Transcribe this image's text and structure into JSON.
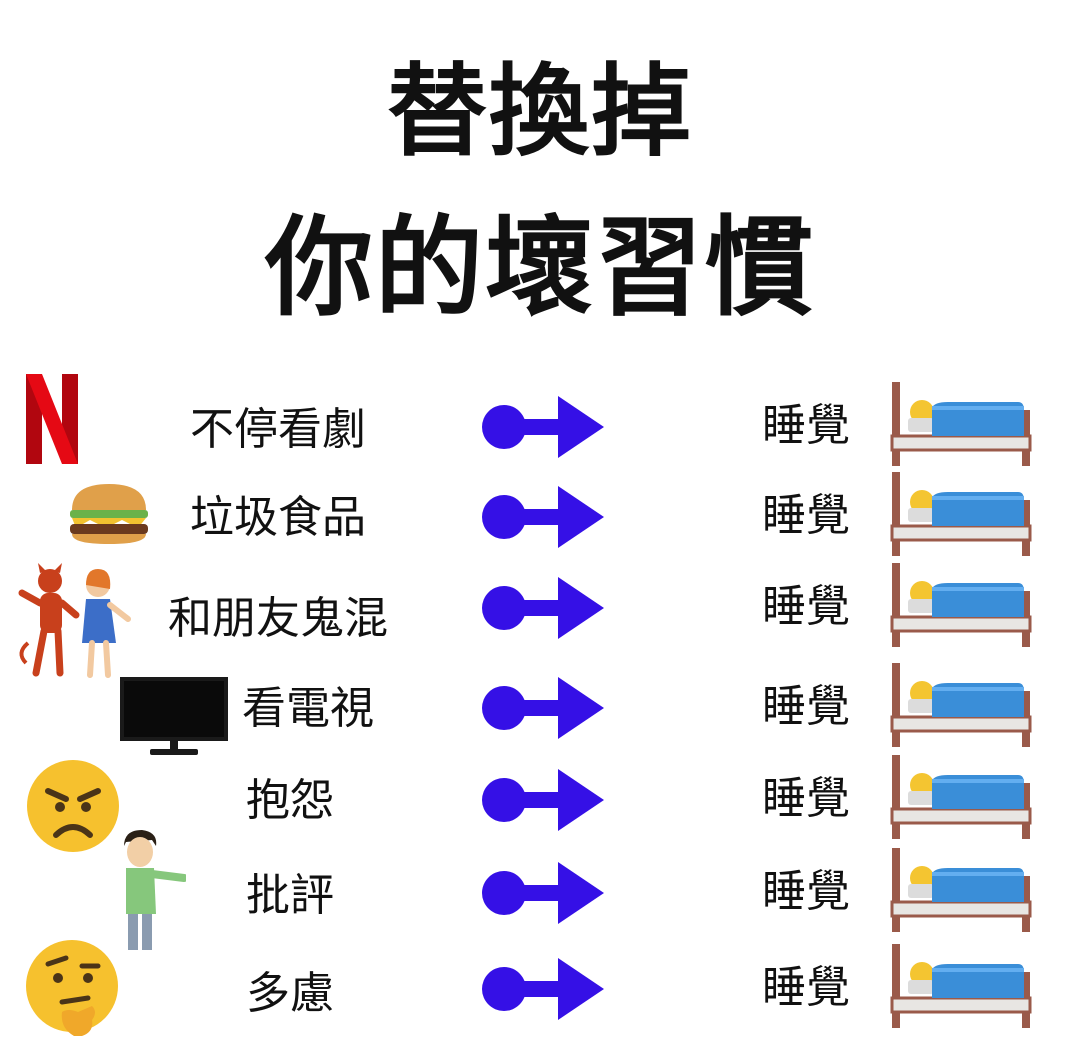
{
  "title": {
    "line1": "替換掉",
    "line2": "你的壞習慣"
  },
  "arrow_color": "#3510e6",
  "rows": [
    {
      "icon": "netflix-logo-icon",
      "habit": "不停看劇",
      "result": "睡覺",
      "result_icon": "person-in-bed-icon"
    },
    {
      "icon": "hamburger-icon",
      "habit": "垃圾食品",
      "result": "睡覺",
      "result_icon": "person-in-bed-icon"
    },
    {
      "icon": "devil-and-girl-icon",
      "habit": "和朋友鬼混",
      "result": "睡覺",
      "result_icon": "person-in-bed-icon"
    },
    {
      "icon": "television-icon",
      "habit": "看電視",
      "result": "睡覺",
      "result_icon": "person-in-bed-icon"
    },
    {
      "icon": "angry-face-icon",
      "habit": "抱怨",
      "result": "睡覺",
      "result_icon": "person-in-bed-icon"
    },
    {
      "icon": "pointing-man-icon",
      "habit": "批評",
      "result": "睡覺",
      "result_icon": "person-in-bed-icon"
    },
    {
      "icon": "thinking-face-icon",
      "habit": "多慮",
      "result": "睡覺",
      "result_icon": "person-in-bed-icon"
    }
  ]
}
